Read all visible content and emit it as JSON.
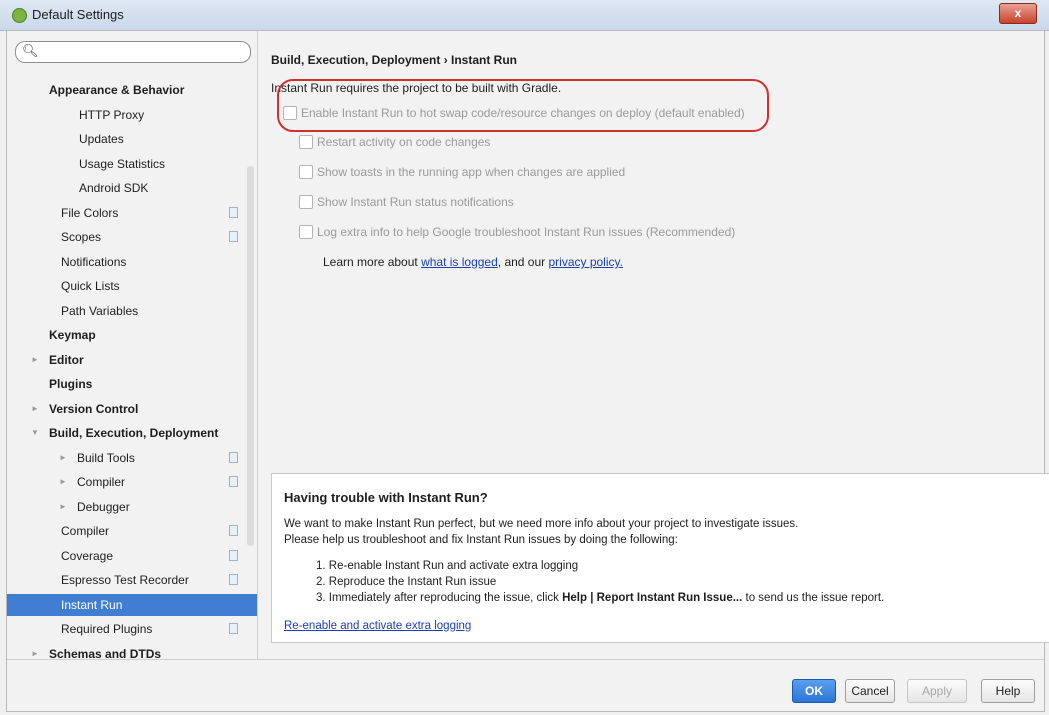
{
  "window": {
    "title": "Default Settings",
    "close_glyph": "x"
  },
  "search": {
    "placeholder": "",
    "icon": "search-icon"
  },
  "tree": [
    {
      "label": "Appearance & Behavior",
      "bold": true,
      "indent": 0,
      "arrow": ""
    },
    {
      "label": "HTTP Proxy",
      "indent": 2
    },
    {
      "label": "Updates",
      "indent": 2
    },
    {
      "label": "Usage Statistics",
      "indent": 2
    },
    {
      "label": "Android SDK",
      "indent": 2
    },
    {
      "label": "File Colors",
      "indent": 1,
      "copy": true
    },
    {
      "label": "Scopes",
      "indent": 1,
      "copy": true
    },
    {
      "label": "Notifications",
      "indent": 1
    },
    {
      "label": "Quick Lists",
      "indent": 1
    },
    {
      "label": "Path Variables",
      "indent": 1
    },
    {
      "label": "Keymap",
      "bold": true,
      "indent": 0
    },
    {
      "label": "Editor",
      "bold": true,
      "indent": 0,
      "arrow": "►"
    },
    {
      "label": "Plugins",
      "bold": true,
      "indent": 0
    },
    {
      "label": "Version Control",
      "bold": true,
      "indent": 0,
      "arrow": "►"
    },
    {
      "label": "Build, Execution, Deployment",
      "bold": true,
      "indent": 0,
      "arrow": "▼"
    },
    {
      "label": "Build Tools",
      "indent": 1,
      "arrow": "►",
      "copy": true
    },
    {
      "label": "Compiler",
      "indent": 1,
      "arrow": "►",
      "copy": true
    },
    {
      "label": "Debugger",
      "indent": 1,
      "arrow": "►"
    },
    {
      "label": "Compiler",
      "indent": 1,
      "copy": true
    },
    {
      "label": "Coverage",
      "indent": 1,
      "copy": true
    },
    {
      "label": "Espresso Test Recorder",
      "indent": 1,
      "copy": true
    },
    {
      "label": "Instant Run",
      "indent": 1,
      "selected": true
    },
    {
      "label": "Required Plugins",
      "indent": 1,
      "copy": true
    },
    {
      "label": "Schemas and DTDs",
      "bold": true,
      "indent": 0,
      "arrow": "►"
    }
  ],
  "content": {
    "breadcrumb": "Build, Execution, Deployment › Instant Run",
    "requires_gradle": "Instant Run requires the project to be built with Gradle.",
    "options": [
      "Enable Instant Run to hot swap code/resource changes on deploy (default enabled)",
      "Restart activity on code changes",
      "Show toasts in the running app when changes are applied",
      "Show Instant Run status notifications",
      "Log extra info to help Google troubleshoot Instant Run issues (Recommended)"
    ],
    "learn_more": {
      "prefix": "Learn more about ",
      "link1": "what is logged",
      "middle": ", and our ",
      "link2": "privacy policy."
    },
    "trouble": {
      "heading": "Having trouble with Instant Run?",
      "line1": "We want to make Instant Run perfect, but we need more info about your project to investigate issues.",
      "line2": "Please help us troubleshoot and fix Instant Run issues by doing the following:",
      "step1": "1. Re-enable Instant Run and activate extra logging",
      "step2": "2. Reproduce the Instant Run issue",
      "step3_prefix": "3. Immediately after reproducing the issue, click ",
      "step3_bold": "Help | Report Instant Run Issue...",
      "step3_suffix": " to send us the issue report.",
      "action_link": "Re-enable and activate extra logging"
    }
  },
  "buttons": {
    "ok": "OK",
    "cancel": "Cancel",
    "apply": "Apply",
    "help": "Help"
  },
  "colors": {
    "selection": "#3f7ed1",
    "annotation_ring": "#d32f2f",
    "link": "#1a3fb5",
    "primary_button": "#2c74d7"
  }
}
